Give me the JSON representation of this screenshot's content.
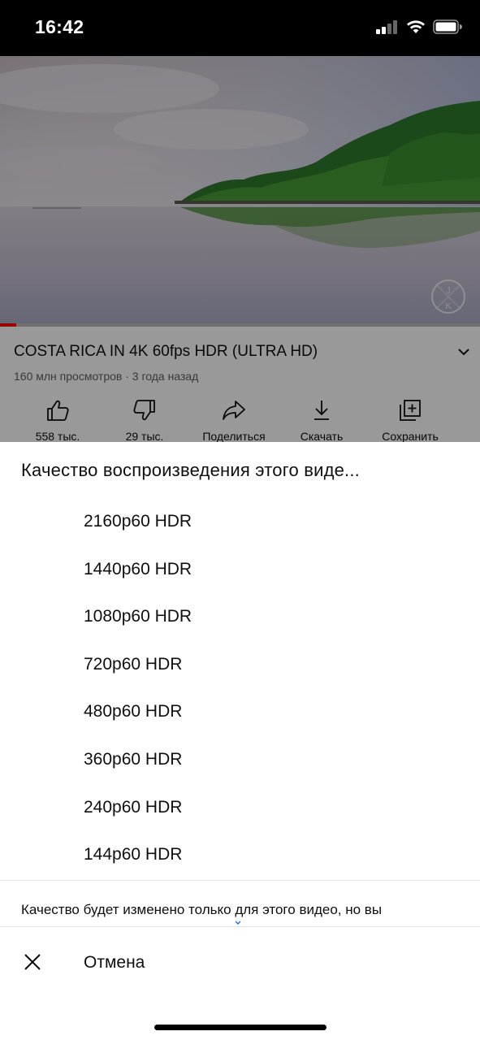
{
  "status_bar": {
    "time": "16:42"
  },
  "video": {
    "title": "COSTA RICA IN 4K 60fps HDR (ULTRA HD)",
    "meta": "160 млн просмотров · 3 года назад",
    "watermark": "JK",
    "progress_fraction": 0.034
  },
  "actions": [
    {
      "label": "558 тыс.",
      "icon": "thumbs-up-icon"
    },
    {
      "label": "29 тыс.",
      "icon": "thumbs-down-icon"
    },
    {
      "label": "Поделиться",
      "icon": "share-icon"
    },
    {
      "label": "Скачать",
      "icon": "download-icon"
    },
    {
      "label": "Сохранить",
      "icon": "save-to-playlist-icon"
    }
  ],
  "quality_sheet": {
    "title": "Качество воспроизведения этого виде...",
    "options": [
      "2160p60 HDR",
      "1440p60 HDR",
      "1080p60 HDR",
      "720p60 HDR",
      "480p60 HDR",
      "360p60 HDR",
      "240p60 HDR",
      "144p60 HDR"
    ],
    "note": "Качество будет изменено только для этого видео, но вы",
    "cancel_label": "Отмена"
  },
  "colors": {
    "accent_red": "#ff0000",
    "text_primary": "#0f0f0f",
    "text_secondary": "#606060",
    "scroll_dot": "#1a73e8"
  }
}
